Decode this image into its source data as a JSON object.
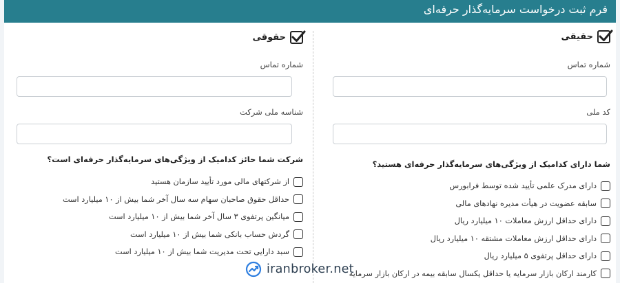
{
  "header": {
    "title": "فرم ثبت درخواست سرمایه‌گذار حرفه‌ای"
  },
  "real_person": {
    "type_label": "حقیقی",
    "checked": true,
    "fields": [
      {
        "label": "شماره تماس",
        "value": ""
      },
      {
        "label": "کد ملی",
        "value": ""
      }
    ],
    "question": "شما دارای کدامیک از ویژگی‌های سرمایه‌گذار حرفه‌ای هستید؟",
    "options": [
      "دارای مدرک علمی تأیید شده توسط فرابورس",
      "سابقه عضویت در هیأت مدیره نهادهای مالی",
      "دارای حداقل ارزش معاملات ۱۰ میلیارد ریال",
      "دارای حداقل ارزش معاملات مشتقه ۱۰ میلیارد ریال",
      "دارای حداقل پرتفوی ۵ میلیارد ریال",
      "کارمند ارکان بازار سرمایه یا حداقل یکسال سابقه بیمه در ارکان بازار سرمایه"
    ]
  },
  "legal_person": {
    "type_label": "حقوقی",
    "checked": true,
    "fields": [
      {
        "label": "شماره تماس",
        "value": ""
      },
      {
        "label": "شناسه ملی شرکت",
        "value": ""
      }
    ],
    "question": "شرکت شما حائز کدامیک از ویژگی‌های سرمایه‌گذار حرفه‌ای است؟",
    "options": [
      "از شرکتهای مالی مورد تأیید سازمان هستید",
      "حداقل حقوق صاحبان سهام سه سال آخر شما بیش از ۱۰ میلیارد است",
      "میانگین پرتفوی ۳ سال آخر شما بیش از ۱۰ میلیارد است",
      "گردش حساب بانکی شما بیش از ۱۰ میلیارد است",
      "سبد دارایی تحت مدیریت شما بیش از ۱۰ میلیارد است"
    ]
  },
  "watermark": {
    "text": "iranbroker.net",
    "icon": "chart-trend-icon"
  },
  "colors": {
    "header_bg": "#277e8e",
    "page_bg": "#f1f4f7"
  }
}
